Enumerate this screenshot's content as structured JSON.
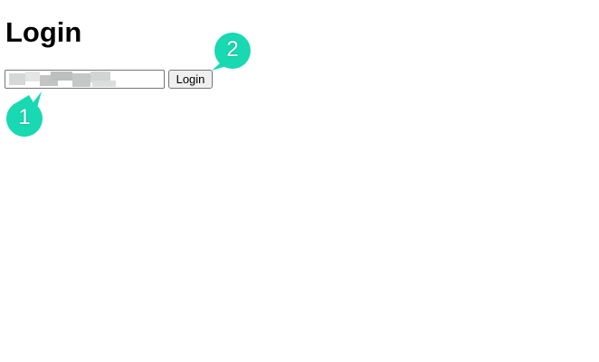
{
  "page": {
    "title": "Login"
  },
  "form": {
    "username_value_redacted": true,
    "login_label": "Login"
  },
  "annotations": {
    "marker_color": "#18d9b1",
    "markers": [
      {
        "label": "1"
      },
      {
        "label": "2"
      }
    ]
  }
}
